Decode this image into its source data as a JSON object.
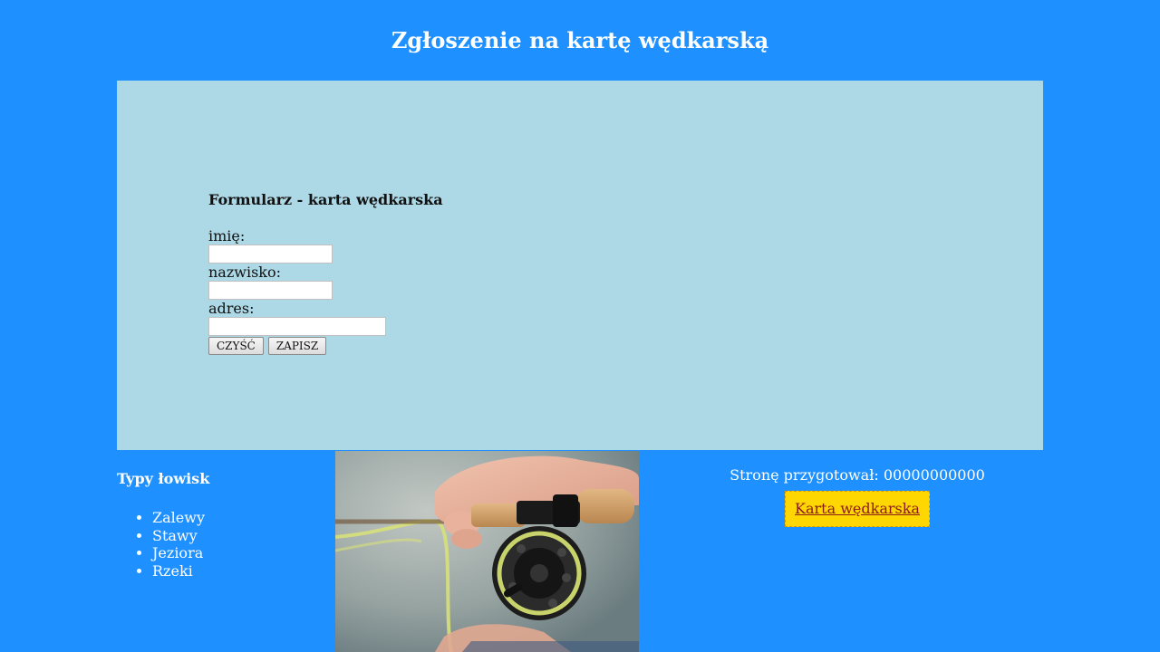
{
  "header": {
    "title": "Zgłoszenie na kartę wędkarską"
  },
  "form": {
    "heading": "Formularz - karta wędkarska",
    "first_name_label": "imię:",
    "first_name_value": "",
    "last_name_label": "nazwisko:",
    "last_name_value": "",
    "address_label": "adres:",
    "address_value": "",
    "clear_label": "CZYŚĆ",
    "save_label": "ZAPISZ"
  },
  "fishing_types": {
    "heading": "Typy łowisk",
    "items": [
      "Zalewy",
      "Stawy",
      "Jeziora",
      "Rzeki"
    ]
  },
  "footer": {
    "author_text": "Stronę przygotował: 00000000000",
    "card_link_label": "Karta wędkarska"
  },
  "colors": {
    "page_background": "#1e90ff",
    "panel_background": "#add8e6",
    "link_box_background": "#ffd700",
    "link_color": "#8b1a1a"
  }
}
